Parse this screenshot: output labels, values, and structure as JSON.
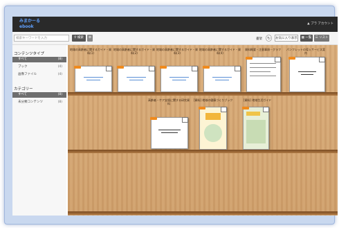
{
  "header": {
    "logo_line1": "みまかーる",
    "logo_line2": "ebook",
    "account": "▲ プラ アカウント"
  },
  "toolbar": {
    "search_placeholder": "検索キーワードを入力",
    "search_button": "検索",
    "sort_label": "書架",
    "count_button": "お気に入り表示",
    "btn_a": "一覧",
    "btn_b": "リスト"
  },
  "sidebar": {
    "heading_content": "コンテンツタイプ",
    "content_items": [
      {
        "label": "すべて",
        "count": "(8)"
      },
      {
        "label": "ブック",
        "count": "(4)"
      },
      {
        "label": "画像ファイル",
        "count": "(4)"
      }
    ],
    "heading_category": "カテゴリー",
    "category_items": [
      {
        "label": "すべて",
        "count": "(8)"
      },
      {
        "label": "未分類コンテンツ",
        "count": "(8)"
      }
    ]
  },
  "books_row1": [
    {
      "title": "地域の高齢者に関するガイド・資料(1)"
    },
    {
      "title": "地域の高齢者に関するガイド・資料(2)"
    },
    {
      "title": "地域の高齢者に関するガイド・資料(3)"
    },
    {
      "title": "地域の高齢者に関するガイド・資料(4)"
    },
    {
      "title": "資料概要・注意事項・グラフ"
    },
    {
      "title": "パンフレットの導入サービス案内"
    }
  ],
  "books_row2": [
    {
      "title": "高齢者・ケア支援に関する研究資料"
    },
    {
      "title": "[資料] 地域の健康づくりブック"
    },
    {
      "title": "[資料] 地域生活ガイド"
    }
  ],
  "colors": {
    "topbar": "#2a2a2a",
    "accent_tag": "#f08a1c",
    "sidebar_active": "#6e6e6e"
  }
}
